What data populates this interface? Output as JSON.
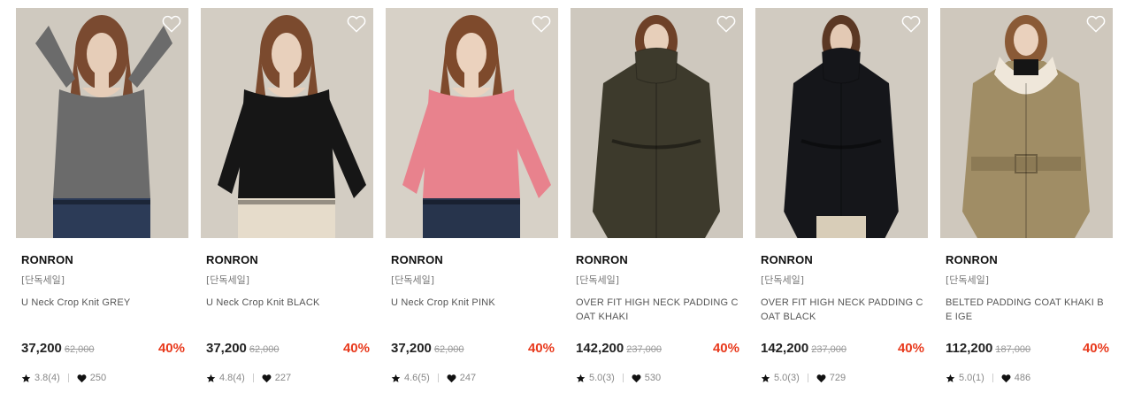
{
  "products": [
    {
      "brand": "RONRON",
      "tag": "[단독세일]",
      "name": "U Neck Crop Knit GREY",
      "price": "37,200",
      "original_price": "62,000",
      "discount": "40%",
      "rating": "3.8(4)",
      "likes": "250",
      "photo": {
        "bg": "#cfc9bf",
        "garment": "#6b6b6b",
        "lower": "#2c3b57",
        "hair": "#7a4a30",
        "skin": "#e6cdb8",
        "pose": "arms-up"
      }
    },
    {
      "brand": "RONRON",
      "tag": "[단독세일]",
      "name": "U Neck Crop Knit BLACK",
      "price": "37,200",
      "original_price": "62,000",
      "discount": "40%",
      "rating": "4.8(4)",
      "likes": "227",
      "photo": {
        "bg": "#d3cdc3",
        "garment": "#161616",
        "lower": "#e6dccb",
        "hair": "#7b4a2e",
        "skin": "#e8d0bc",
        "pose": "hip"
      }
    },
    {
      "brand": "RONRON",
      "tag": "[단독세일]",
      "name": "U Neck Crop Knit PINK",
      "price": "37,200",
      "original_price": "62,000",
      "discount": "40%",
      "rating": "4.6(5)",
      "likes": "247",
      "photo": {
        "bg": "#d7d1c7",
        "garment": "#e8828d",
        "lower": "#27344c",
        "hair": "#7e4a2c",
        "skin": "#ebd2be",
        "pose": "hip"
      }
    },
    {
      "brand": "RONRON",
      "tag": "[단독세일]",
      "name": "OVER FIT HIGH NECK PADDING C OAT KHAKI",
      "price": "142,200",
      "original_price": "237,000",
      "discount": "40%",
      "rating": "5.0(3)",
      "likes": "530",
      "photo": {
        "bg": "#cec8be",
        "garment": "#3d3a2c",
        "lower": "#3d3a2c",
        "hair": "#6e4128",
        "skin": "#e7cfba",
        "pose": "coat"
      }
    },
    {
      "brand": "RONRON",
      "tag": "[단독세일]",
      "name": "OVER FIT HIGH NECK PADDING C OAT BLACK",
      "price": "142,200",
      "original_price": "237,000",
      "discount": "40%",
      "rating": "5.0(3)",
      "likes": "729",
      "photo": {
        "bg": "#d1cbc1",
        "garment": "#15161a",
        "lower": "#d8cdb8",
        "hair": "#5b3824",
        "skin": "#e3c9b4",
        "pose": "coat-small"
      }
    },
    {
      "brand": "RONRON",
      "tag": "[단독세일]",
      "name": "BELTED PADDING COAT KHAKI BE IGE",
      "price": "112,200",
      "original_price": "187,000",
      "discount": "40%",
      "rating": "5.0(1)",
      "likes": "486",
      "photo": {
        "bg": "#cfc8bd",
        "garment": "#a08d65",
        "lower": "#a08d65",
        "hair": "#8a5a36",
        "skin": "#ead1bd",
        "pose": "belted"
      }
    }
  ],
  "colors": {
    "discount": "#e8391c",
    "brand_text": "#111111",
    "muted_text": "#888888"
  },
  "icons": {
    "wishlist": "heart-outline-icon",
    "rating": "star-icon",
    "likes": "heart-filled-icon"
  }
}
